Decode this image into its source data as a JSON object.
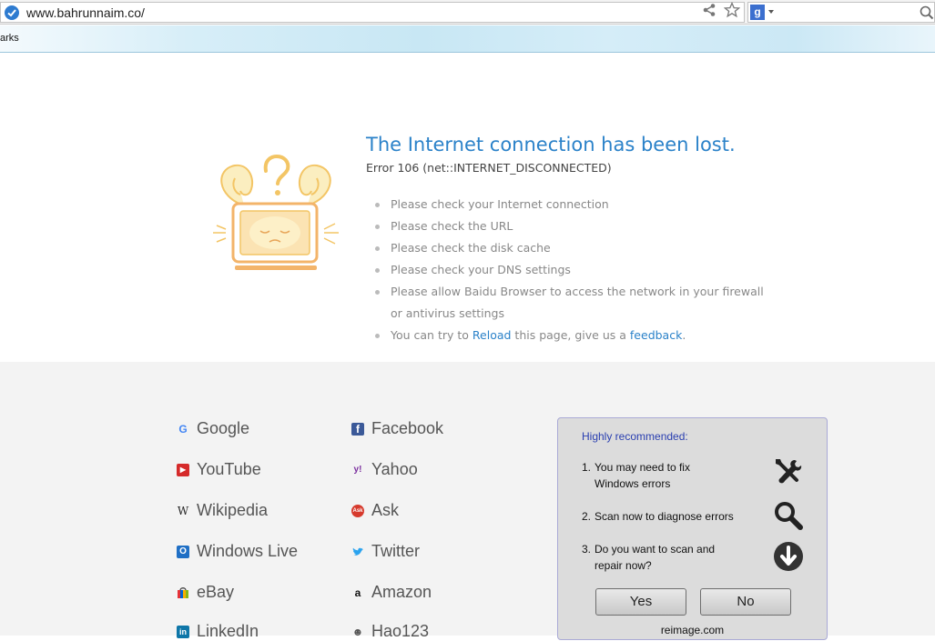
{
  "browser": {
    "url": "www.bahrunnaim.co/",
    "bookmarks_label": "arks",
    "search_engine_letter": "g",
    "colors": {
      "accent": "#2b82c9",
      "bookmark_bar": "#c8e7f4"
    }
  },
  "error": {
    "title": "The Internet connection has been lost.",
    "code": "Error 106 (net::INTERNET_DISCONNECTED)",
    "tips": [
      "Please check your Internet connection",
      "Please check the URL",
      "Please check the disk cache",
      "Please check your DNS settings",
      "Please allow Baidu Browser to access the network in your firewall",
      "or antivirus settings"
    ],
    "reload_prefix": "You can try to",
    "reload_link": "Reload",
    "reload_middle": "this page, give us a",
    "feedback_link": "feedback",
    "reload_suffix": "."
  },
  "links": [
    {
      "label": "Google",
      "icon": "google-icon"
    },
    {
      "label": "Facebook",
      "icon": "facebook-icon"
    },
    {
      "label": "YouTube",
      "icon": "youtube-icon"
    },
    {
      "label": "Yahoo",
      "icon": "yahoo-icon"
    },
    {
      "label": "Wikipedia",
      "icon": "wikipedia-icon"
    },
    {
      "label": "Ask",
      "icon": "ask-icon"
    },
    {
      "label": "Windows Live",
      "icon": "outlook-icon"
    },
    {
      "label": "Twitter",
      "icon": "twitter-icon"
    },
    {
      "label": "eBay",
      "icon": "ebay-icon"
    },
    {
      "label": "Amazon",
      "icon": "amazon-icon"
    },
    {
      "label": "LinkedIn",
      "icon": "linkedin-icon"
    },
    {
      "label": "Hao123",
      "icon": "hao123-icon"
    }
  ],
  "link_icon_glyphs": {
    "google": "G",
    "facebook": "f",
    "youtube": "▶",
    "yahoo": "y!",
    "wikipedia": "W",
    "ask": "Ask",
    "outlook": "O",
    "twitter": "🐦",
    "ebay": "b",
    "amazon": "a",
    "linkedin": "in",
    "hao123": "☻"
  },
  "popup": {
    "title": "Highly recommended:",
    "items": [
      {
        "num": "1.",
        "line1": "You may need to fix",
        "line2": "Windows errors",
        "icon": "tools-icon"
      },
      {
        "num": "2.",
        "line1": "Scan now to diagnose errors",
        "line2": "",
        "icon": "magnifier-icon"
      },
      {
        "num": "3.",
        "line1": "Do you want to scan and",
        "line2": "repair now?",
        "icon": "download-arrow-icon"
      }
    ],
    "yes_label": "Yes",
    "no_label": "No",
    "footer": "reimage.com"
  }
}
